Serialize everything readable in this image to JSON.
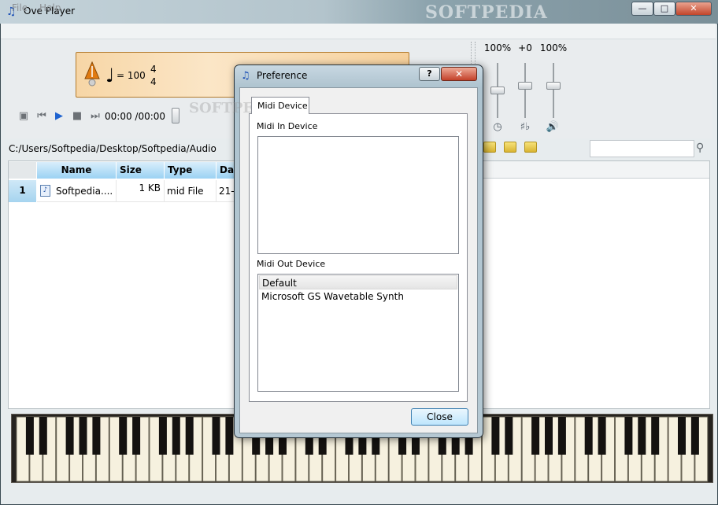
{
  "window": {
    "title": "Ove Player",
    "watermark": "SOFTPEDIA",
    "min": "—",
    "max": "□",
    "close": "✕"
  },
  "menu": {
    "file": "File",
    "help": "Help"
  },
  "transport": {
    "tempo": "= 100",
    "time_sig_top": "4",
    "time_sig_bottom": "4",
    "time": "00:00 /00:00"
  },
  "mixer": {
    "vol1": "100%",
    "pitch": "+0",
    "vol2": "100%",
    "sharpflat": "♯♭"
  },
  "path": "C:/Users/Softpedia/Desktop/Softpedia/Audio",
  "table": {
    "headers": {
      "name": "Name",
      "size": "Size",
      "type": "Type",
      "date": "Da"
    },
    "rows": [
      {
        "num": "1",
        "name": "Softpedia....",
        "size": "1 KB",
        "type": "mid File",
        "date": "21-"
      }
    ]
  },
  "dialog": {
    "title": "Preference",
    "help": "?",
    "close_x": "✕",
    "tab": "Midi Device",
    "in_label": "Midi In Device",
    "out_label": "Midi Out Device",
    "out_options": [
      "Default",
      "Microsoft GS Wavetable Synth"
    ],
    "close_button": "Close"
  },
  "colors": {
    "accent": "#1f63d0",
    "header_blue": "#9bd2f3",
    "transport_orange": "#f7d6a6"
  }
}
